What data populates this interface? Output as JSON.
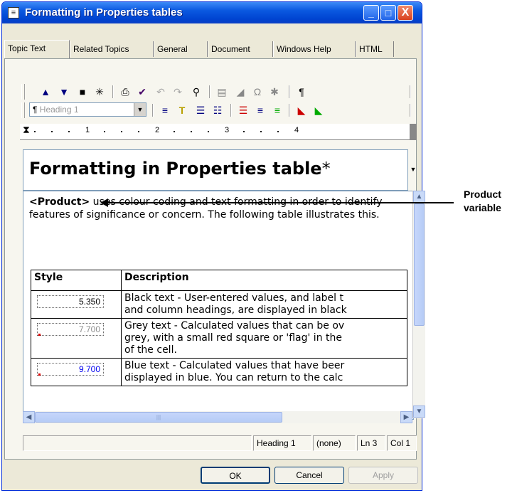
{
  "window": {
    "title": "Formatting in Properties tables",
    "controls": {
      "minimize": "_",
      "maximize": "□",
      "close": "X"
    }
  },
  "tabs": [
    "Topic Text",
    "Related Topics",
    "General",
    "Document",
    "Windows Help",
    "HTML"
  ],
  "active_tab": "Topic Text",
  "toolbar1_icons": [
    "arrow-up-icon",
    "arrow-down-icon",
    "save-icon",
    "magic-icon",
    "print-icon",
    "spellcheck-icon",
    "undo-icon",
    "redo-icon",
    "find-icon",
    "ole-icon",
    "paint-icon",
    "omega-icon",
    "special-char-icon",
    "pilcrow-icon"
  ],
  "style_select": {
    "value": "Heading 1",
    "marker": "¶"
  },
  "ruler": {
    "labels": [
      "1",
      "2",
      "3",
      "4"
    ]
  },
  "document": {
    "heading": "Formatting in Properties table",
    "heading_marker": "*",
    "paragraph": {
      "variable": "<Product>",
      "text": " uses colour coding and text formatting in order to identify features of significance or concern. The following table illustrates this."
    },
    "table": {
      "headers": [
        "Style",
        "Description"
      ],
      "rows": [
        {
          "value": "5.350",
          "color": "#000000",
          "flag": false,
          "desc": [
            "Black text - User-entered values, and label t",
            "and column headings, are displayed in black"
          ]
        },
        {
          "value": "7.700",
          "color": "#8c8c8c",
          "flag": true,
          "desc": [
            "Grey text - Calculated values that can be ov",
            "grey, with a small red square or 'flag' in the",
            "of the cell."
          ]
        },
        {
          "value": "9.700",
          "color": "#0000ee",
          "flag": true,
          "desc": [
            "Blue text - Calculated values that have beer",
            "displayed in blue.  You can return to the calc"
          ]
        }
      ]
    }
  },
  "statusbar": {
    "style": "Heading 1",
    "font": "(none)",
    "line": "Ln 3",
    "col": "Col 1"
  },
  "buttons": {
    "ok": "OK",
    "cancel": "Cancel",
    "apply": "Apply"
  },
  "annotation": {
    "line1": "Product",
    "line2": "variable"
  }
}
